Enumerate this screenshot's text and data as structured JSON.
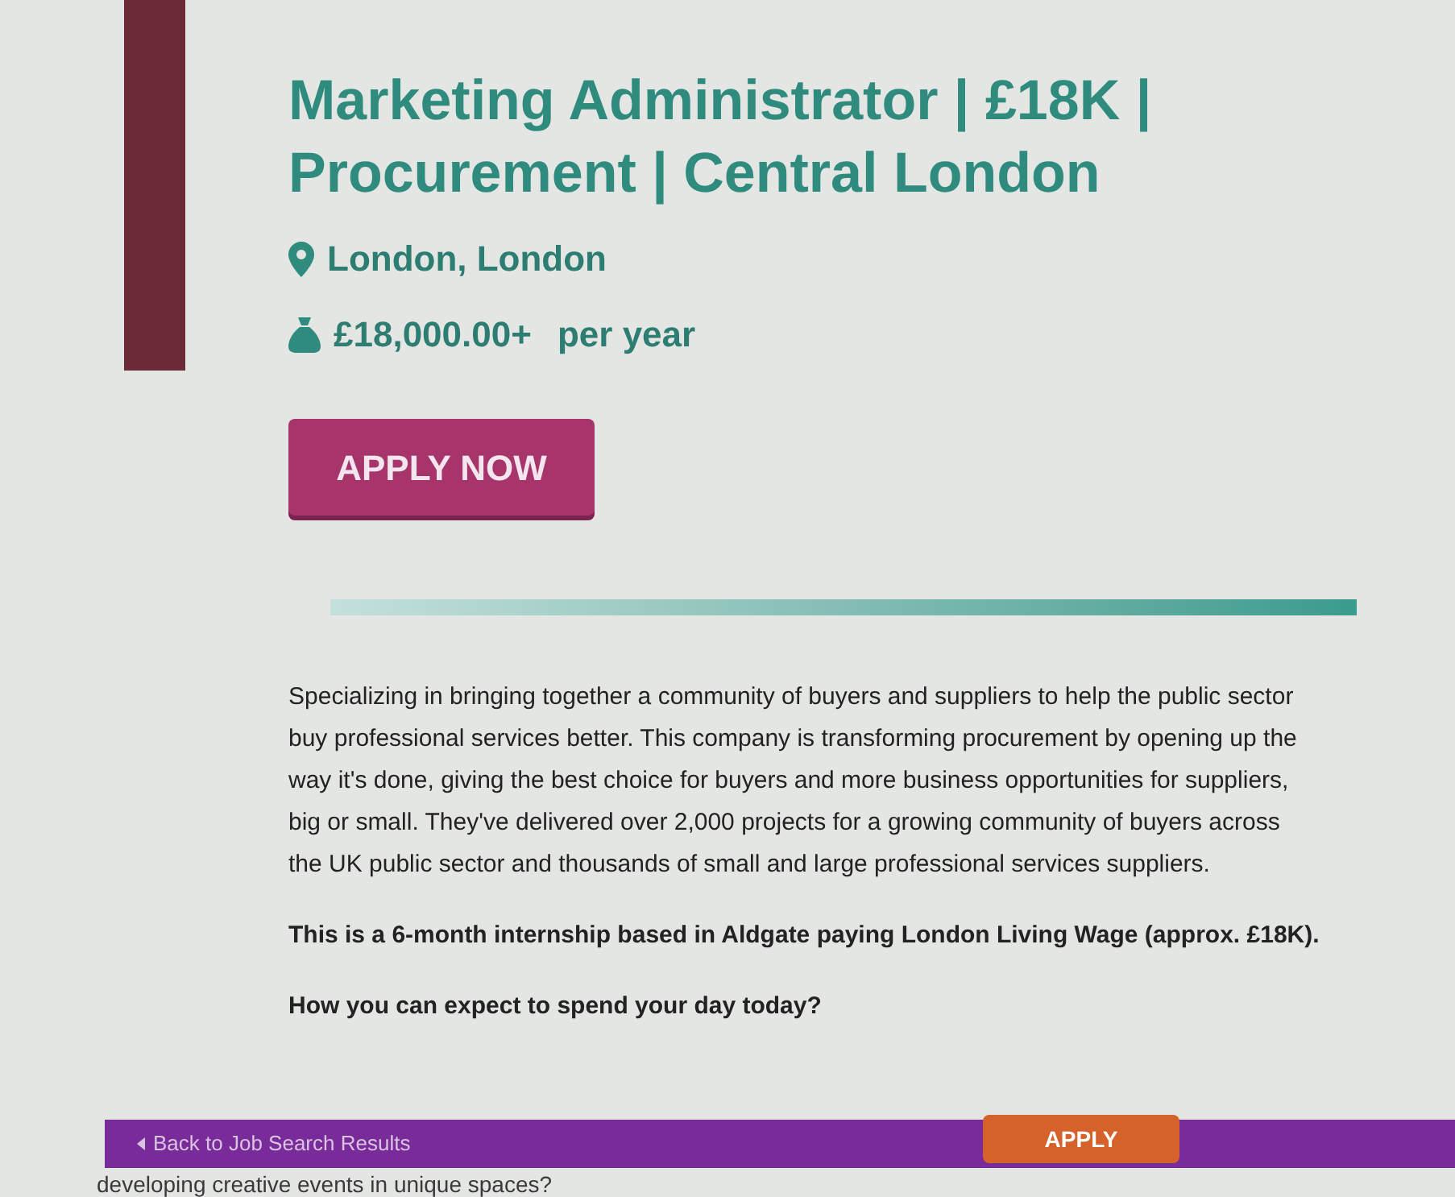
{
  "job": {
    "title": "Marketing Administrator | £18K | Procurement | Central London",
    "location": "London, London",
    "salary": "£18,000.00+",
    "salary_period": "per year",
    "apply_button": "APPLY NOW"
  },
  "description": [
    "Specializing in bringing together a community of buyers and suppliers to help the public sector buy professional services better. This company is transforming procurement by opening up the way it's done, giving the best choice for buyers and more business opportunities for suppliers, big or small.  They've delivered over 2,000 projects for a growing community of buyers across the UK public sector and thousands of small and large professional services suppliers.",
    "**This is a 6-month internship based in Aldgate paying London Living Wage (approx. £18K).**",
    "**How you can expect to spend your day today?**"
  ],
  "bottom_bar": {
    "back_link": "Back to Job Search Results",
    "apply_button": "APPLY"
  },
  "below_bar_text": "developing creative events in unique spaces?"
}
